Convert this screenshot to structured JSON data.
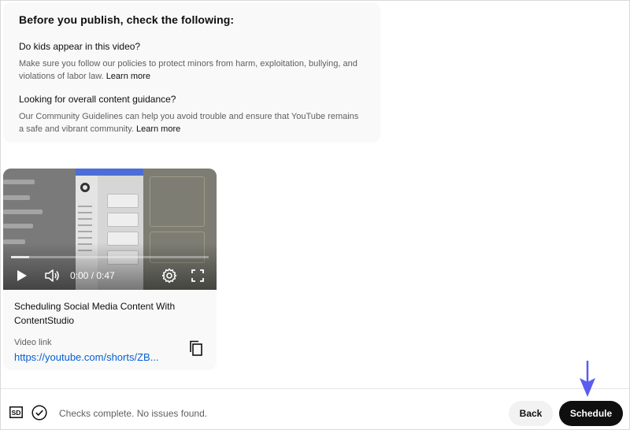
{
  "checklist": {
    "title": "Before you publish, check the following:",
    "items": [
      {
        "heading": "Do kids appear in this video?",
        "text": "Make sure you follow our policies to protect minors from harm, exploitation, bullying, and violations of labor law.",
        "link": "Learn more"
      },
      {
        "heading": "Looking for overall content guidance?",
        "text": "Our Community Guidelines can help you avoid trouble and ensure that YouTube remains a safe and vibrant community.",
        "link": "Learn more"
      }
    ]
  },
  "video": {
    "time": "0:00 / 0:47",
    "progress": 0.09,
    "title": "Scheduling Social Media Content With ContentStudio",
    "link_label": "Video link",
    "link_url": "https://youtube.com/shorts/ZB..."
  },
  "footer": {
    "quality_badge": "SD",
    "status": "Checks complete. No issues found.",
    "back_label": "Back",
    "schedule_label": "Schedule"
  },
  "colors": {
    "link": "#065fd4",
    "primary_button": "#0f0f0f",
    "secondary_button": "#f2f2f2",
    "annotation_arrow": "#5b5cf0"
  }
}
